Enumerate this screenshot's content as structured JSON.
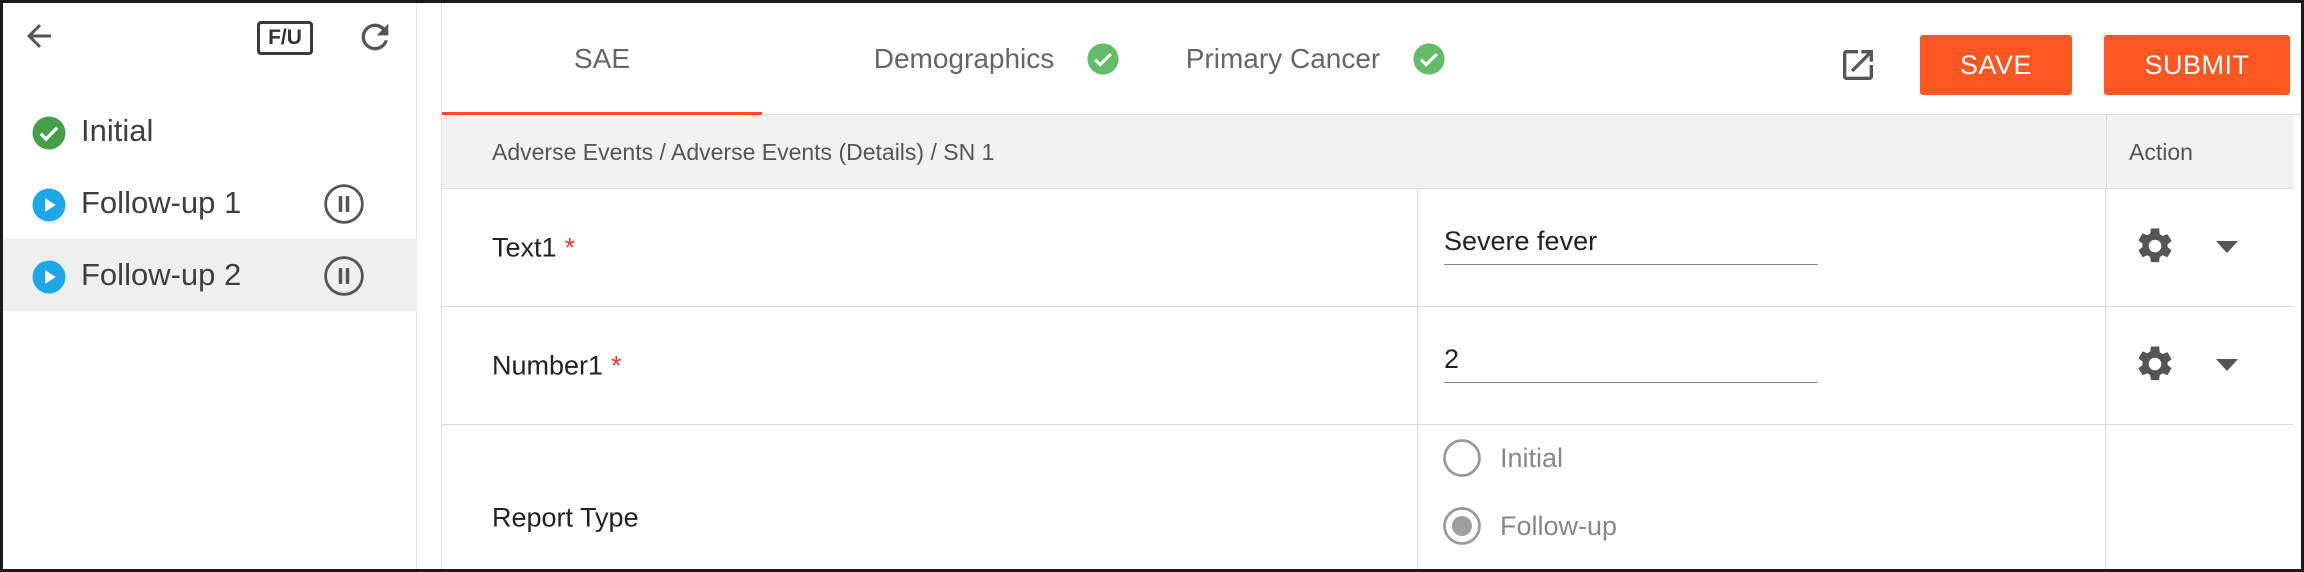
{
  "sidebar": {
    "fu_label": "F/U",
    "items": [
      {
        "label": "Initial",
        "status": "complete"
      },
      {
        "label": "Follow-up 1",
        "status": "in-progress"
      },
      {
        "label": "Follow-up 2",
        "status": "in-progress",
        "selected": true
      }
    ]
  },
  "tabs": [
    {
      "label": "SAE",
      "active": true
    },
    {
      "label": "Demographics",
      "complete": true
    },
    {
      "label": "Primary Cancer",
      "complete": true
    }
  ],
  "toolbar": {
    "save_label": "SAVE",
    "submit_label": "SUBMIT"
  },
  "table": {
    "breadcrumb": "Adverse Events / Adverse Events (Details) / SN 1",
    "action_header": "Action",
    "rows": [
      {
        "label": "Text1",
        "required": "*",
        "value": "Severe fever"
      },
      {
        "label": "Number1",
        "required": "*",
        "value": "2"
      },
      {
        "label": "Report Type",
        "options": [
          "Initial",
          "Follow-up"
        ],
        "selected": "Follow-up"
      }
    ]
  },
  "colors": {
    "accent": "#ff5722",
    "complete_green": "#43a047",
    "progress_blue": "#1ea7e8",
    "required_red": "#e53935"
  },
  "icons": [
    "back-arrow-icon",
    "refresh-icon",
    "check-circle-icon",
    "play-circle-icon",
    "pause-circle-icon",
    "external-link-icon",
    "gear-icon",
    "caret-down-icon"
  ]
}
